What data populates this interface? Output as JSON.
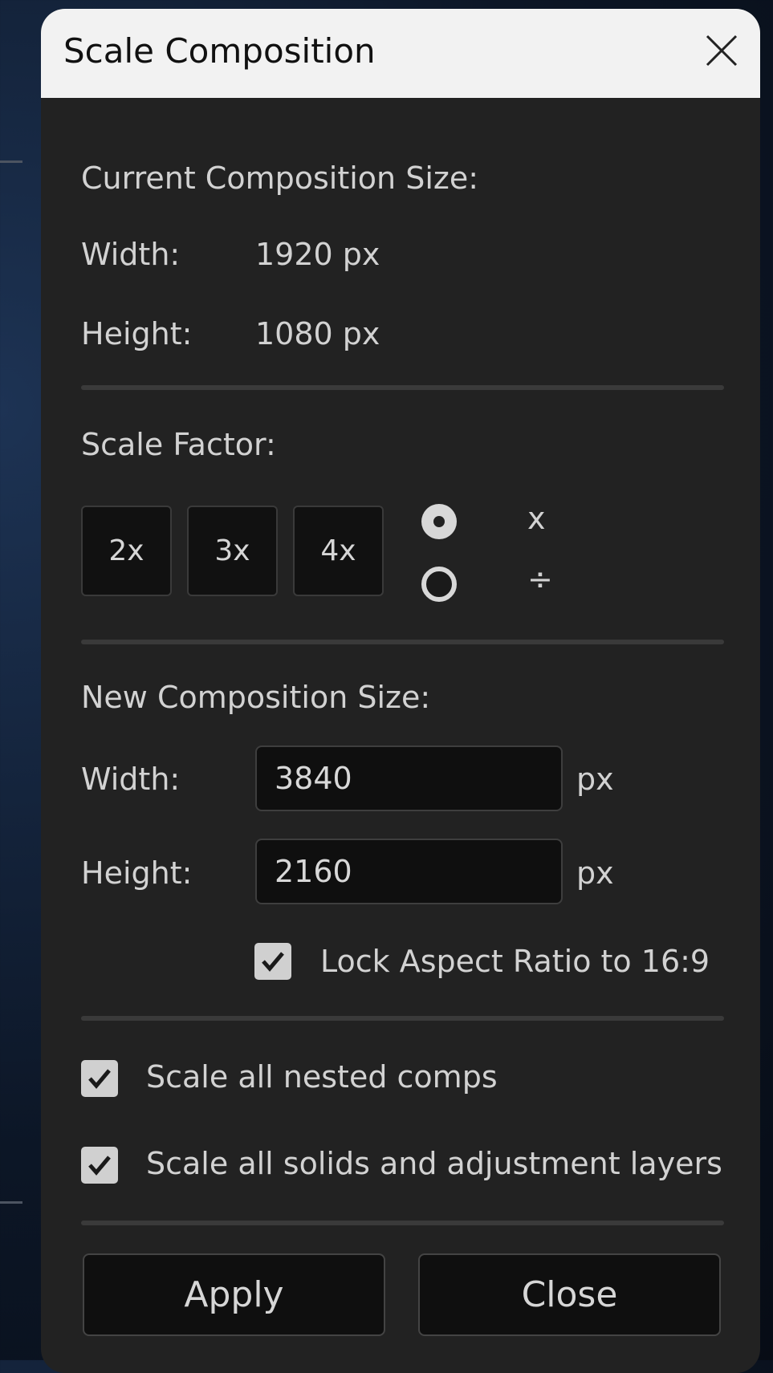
{
  "dialog": {
    "title": "Scale Composition",
    "close_icon": "close-icon"
  },
  "current_size": {
    "heading": "Current Composition Size:",
    "width_label": "Width:",
    "width_value": "1920 px",
    "height_label": "Height:",
    "height_value": "1080 px"
  },
  "scale_factor": {
    "heading": "Scale Factor:",
    "buttons": [
      "2x",
      "3x",
      "4x"
    ],
    "modes": [
      {
        "label": "x",
        "selected": true
      },
      {
        "label": "÷",
        "selected": false
      }
    ]
  },
  "new_size": {
    "heading": "New Composition Size:",
    "width_label": "Width:",
    "width_value": "3840",
    "height_label": "Height:",
    "height_value": "2160",
    "unit": "px",
    "lock_aspect_label": "Lock Aspect Ratio to 16:9",
    "lock_aspect_checked": true
  },
  "options": {
    "nested_comps_label": "Scale all nested comps",
    "nested_comps_checked": true,
    "solids_label": "Scale all solids and adjustment layers",
    "solids_checked": true
  },
  "actions": {
    "apply_label": "Apply",
    "close_label": "Close"
  },
  "colors": {
    "dialog_bg": "#222222",
    "titlebar_bg": "#f2f2f2",
    "button_bg": "#0f0f0f",
    "text": "#d2d2d2"
  }
}
